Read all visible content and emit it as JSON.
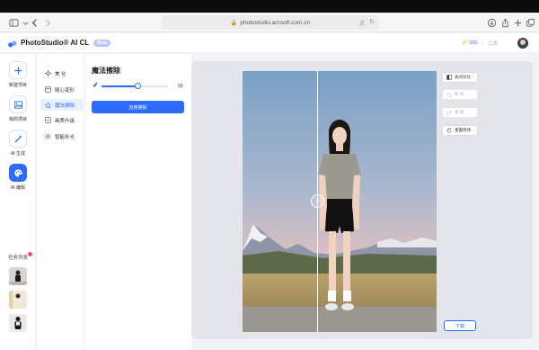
{
  "browser": {
    "url": "photostudio.arcsoft.com.cn"
  },
  "header": {
    "app_name": "PhotoStudio® AI CL",
    "badge": "Beta",
    "points": "200",
    "points_suffix": "二次",
    "accent": "#2d6bff"
  },
  "rail": {
    "items": [
      {
        "label": "新建项目",
        "icon": "plus-icon"
      },
      {
        "label": "我的项目",
        "icon": "image-icon"
      },
      {
        "label": "AI 生成",
        "icon": "magic-wand-icon"
      },
      {
        "label": "AI 编辑",
        "icon": "palette-icon"
      }
    ],
    "tasks_title": "任务列表"
  },
  "tools": {
    "items": [
      {
        "label": "美 化",
        "icon": "sparkle-icon"
      },
      {
        "label": "随心变形",
        "icon": "warp-icon"
      },
      {
        "label": "魔法擦除",
        "icon": "eraser-icon",
        "active": true
      },
      {
        "label": "画质升级",
        "icon": "upscale-icon"
      },
      {
        "label": "智能补光",
        "icon": "sun-icon"
      }
    ]
  },
  "panel": {
    "title": "魔法擦除",
    "brush_size": 55,
    "brush_max": 100,
    "apply_label": "应用擦除"
  },
  "canvas": {
    "compare_off": "关闭对比",
    "undo": "撤 销",
    "redo": "重 做",
    "reset": "重置修改",
    "download": "下载"
  }
}
